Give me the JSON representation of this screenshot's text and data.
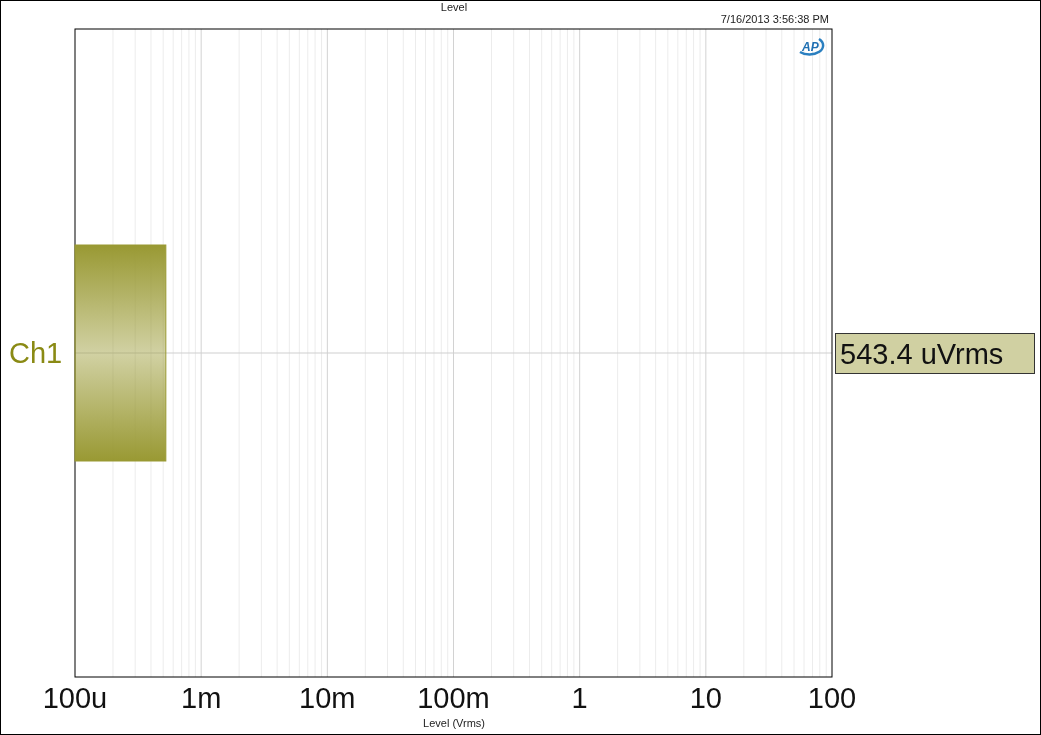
{
  "header": {
    "title": "Level",
    "timestamp": "7/16/2013 3:56:38 PM",
    "logo": "AP"
  },
  "meters": [
    {
      "name": "Ch1",
      "level": 0.12,
      "reading": "543.4 uVrms"
    }
  ],
  "axis": {
    "tick_labels": [
      "100u",
      "1m",
      "10m",
      "100m",
      "1",
      "10",
      "100"
    ],
    "title": "Level (Vrms)"
  }
}
